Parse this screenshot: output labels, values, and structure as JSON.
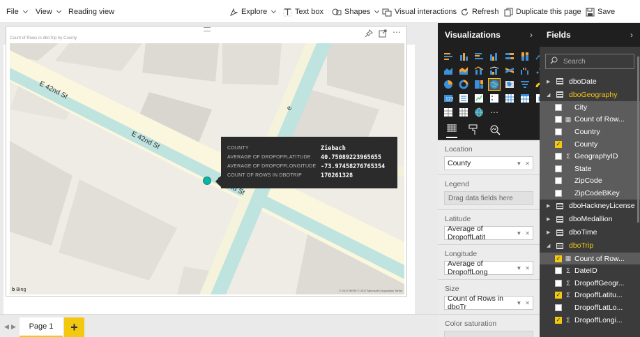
{
  "menu": {
    "file": "File",
    "view": "View",
    "reading_view": "Reading view",
    "explore": "Explore",
    "text_box": "Text box",
    "shapes": "Shapes",
    "visual_interactions": "Visual interactions",
    "refresh": "Refresh",
    "duplicate_page": "Duplicate this page",
    "save": "Save"
  },
  "visual": {
    "title": "Count of Rows in dboTrip by County",
    "streets": [
      "E 42nd St",
      "E 42nd St",
      "E 42nd St",
      "e"
    ],
    "bing": "Bing",
    "copyright": "© 2017 HERE © 2017 Microsoft Corporation  Terms"
  },
  "tooltip": {
    "rows": [
      {
        "key": "COUNTY",
        "value": "Ziebach"
      },
      {
        "key": "AVERAGE OF DROPOFFLATITUDE",
        "value": "40.75089223965655"
      },
      {
        "key": "AVERAGE OF DROPOFFLONGITUDE",
        "value": "-73.97458276765354"
      },
      {
        "key": "COUNT OF ROWS IN DBOTRIP",
        "value": "170261328"
      }
    ]
  },
  "pages": {
    "tab": "Page 1",
    "add": "+"
  },
  "visualizations": {
    "title": "Visualizations",
    "wells": [
      {
        "label": "Location",
        "field": "County",
        "filled": true
      },
      {
        "label": "Legend",
        "field": "Drag data fields here",
        "filled": false
      },
      {
        "label": "Latitude",
        "field": "Average of DropoffLatit",
        "filled": true
      },
      {
        "label": "Longitude",
        "field": "Average of DropoffLong",
        "filled": true
      },
      {
        "label": "Size",
        "field": "Count of Rows in dboTr",
        "filled": true
      },
      {
        "label": "Color saturation",
        "field": "",
        "filled": false
      }
    ]
  },
  "fields": {
    "title": "Fields",
    "search_placeholder": "Search",
    "tables": [
      {
        "name": "dboDate",
        "expanded": false,
        "active": false
      },
      {
        "name": "dboGeography",
        "expanded": true,
        "active": true
      },
      {
        "name": "dboHackneyLicense",
        "expanded": false,
        "active": false
      },
      {
        "name": "dboMedallion",
        "expanded": false,
        "active": false
      },
      {
        "name": "dboTime",
        "expanded": false,
        "active": false
      },
      {
        "name": "dboTrip",
        "expanded": true,
        "active": true
      }
    ],
    "geography_fields": [
      {
        "name": "City",
        "checked": false,
        "icon": ""
      },
      {
        "name": "Count of Row...",
        "checked": false,
        "icon": "calc"
      },
      {
        "name": "Country",
        "checked": false,
        "icon": ""
      },
      {
        "name": "County",
        "checked": true,
        "icon": ""
      },
      {
        "name": "GeographyID",
        "checked": false,
        "icon": "sigma"
      },
      {
        "name": "State",
        "checked": false,
        "icon": ""
      },
      {
        "name": "ZipCode",
        "checked": false,
        "icon": ""
      },
      {
        "name": "ZipCodeBKey",
        "checked": false,
        "icon": ""
      }
    ],
    "trip_fields": [
      {
        "name": "Count of Row...",
        "checked": true,
        "icon": "calc"
      },
      {
        "name": "DateID",
        "checked": false,
        "icon": "sigma"
      },
      {
        "name": "DropoffGeogr...",
        "checked": false,
        "icon": "sigma"
      },
      {
        "name": "DropoffLatitu...",
        "checked": true,
        "icon": "sigma"
      },
      {
        "name": "DropoffLatLo...",
        "checked": false,
        "icon": ""
      },
      {
        "name": "DropoffLongi...",
        "checked": true,
        "icon": "sigma"
      }
    ]
  },
  "colors": {
    "accent": "#f2c811",
    "map_point": "#01b8aa",
    "pane_dark": "#1f1f1f"
  }
}
